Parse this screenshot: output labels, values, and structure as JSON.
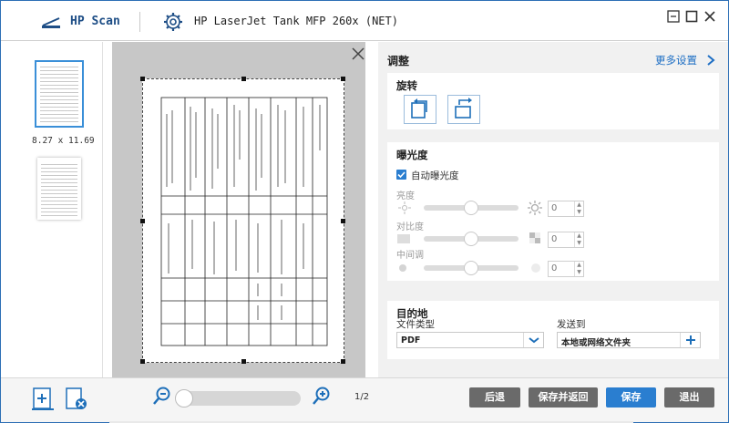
{
  "titlebar": {
    "app_name": "HP Scan",
    "device_name": "HP LaserJet Tank MFP 260x (NET)",
    "logo_icon": "scanner-icon",
    "settings_icon": "gear-icon"
  },
  "thumbnails": {
    "page_size": "8.27 x 11.69"
  },
  "settings": {
    "title": "调整",
    "more_settings": "更多设置",
    "rotate": {
      "title": "旋转"
    },
    "exposure": {
      "title": "曝光度",
      "auto_label": "自动曝光度",
      "auto_checked": true,
      "brightness": {
        "label": "亮度",
        "value": "0",
        "level": 0.5
      },
      "contrast": {
        "label": "对比度",
        "value": "0",
        "level": 0.5
      },
      "midtone": {
        "label": "中间调",
        "value": "0",
        "level": 0.5
      }
    },
    "destination": {
      "title": "目的地",
      "file_type_label": "文件类型",
      "file_type_value": "PDF",
      "send_to_label": "发送到",
      "send_to_value": "本地或网络文件夹"
    }
  },
  "bottombar": {
    "page_indicator": "1/2",
    "zoom_level": 0,
    "back_button": "后退",
    "save_return_button": "保存并返回",
    "save_button": "保存",
    "exit_button": "退出"
  },
  "colors": {
    "accent": "#2a7ed0",
    "title_text": "#1e4e86",
    "gray_button": "#6a6a6a",
    "link": "#1d6ec4"
  }
}
